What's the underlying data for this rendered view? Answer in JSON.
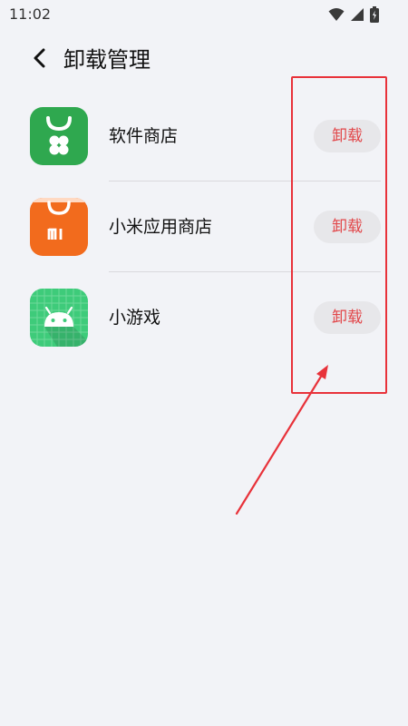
{
  "status_bar": {
    "time": "11:02",
    "icons": [
      "wifi-icon",
      "signal-icon",
      "battery-icon"
    ]
  },
  "header": {
    "title": "卸载管理",
    "back_icon": "back-chevron-icon"
  },
  "apps": [
    {
      "name": "软件商店",
      "button_label": "卸载",
      "icon": "software-store-icon",
      "icon_color": "#2fa84f"
    },
    {
      "name": "小米应用商店",
      "button_label": "卸载",
      "icon": "mi-app-store-icon",
      "icon_color": "#f26b1d"
    },
    {
      "name": "小游戏",
      "button_label": "卸载",
      "icon": "android-game-icon",
      "icon_color": "#3ecb7a"
    }
  ],
  "colors": {
    "background": "#f2f3f7",
    "button_text": "#e2474a",
    "button_bg": "#e7e7ea",
    "annotation": "#e8323a"
  }
}
